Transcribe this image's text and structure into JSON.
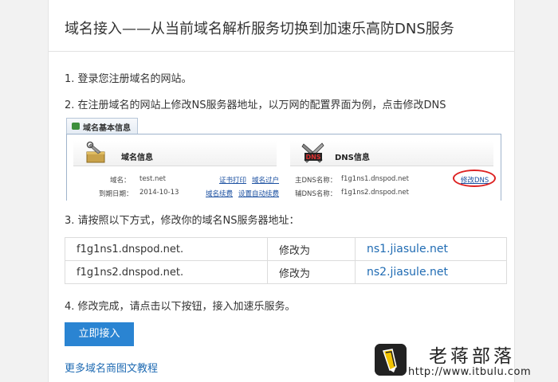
{
  "page": {
    "title": "域名接入——从当前域名解析服务切换到加速乐高防DNS服务"
  },
  "steps": {
    "step1": "1. 登录您注册域名的网站。",
    "step2": "2. 在注册域名的网站上修改NS服务器地址，以万网的配置界面为例，点击修改DNS",
    "step3": "3. 请按照以下方式，修改你的域名NS服务器地址：",
    "step4": "4. 修改完成，请点击以下按钮，接入加速乐服务。"
  },
  "screenshot": {
    "tab_label": "域名基本信息",
    "domain_section_title": "域名信息",
    "dns_section_title": "DNS信息",
    "domain_label": "域名：",
    "domain_value": "test.net",
    "expiry_label": "到期日期：",
    "expiry_value": "2014-10-13",
    "link_cert_print": "证书打印",
    "link_domain_transfer": "域名过户",
    "link_renew": "域名续费",
    "link_auto_renew": "设置自动续费",
    "primary_dns_label": "主DNS名称：",
    "primary_dns_value": "f1g1ns1.dnspod.net",
    "secondary_dns_label": "辅DNS名称：",
    "secondary_dns_value": "f1g1ns2.dnspod.net",
    "modify_dns_link": "修改DNS",
    "dns_icon_text": "DNS"
  },
  "ns_table": {
    "rows": [
      {
        "from": "f1g1ns1.dnspod.net.",
        "action": "修改为",
        "to": "ns1.jiasule.net"
      },
      {
        "from": "f1g1ns2.dnspod.net.",
        "action": "修改为",
        "to": "ns2.jiasule.net"
      }
    ]
  },
  "actions": {
    "connect_button": "立即接入",
    "more_tutorials_link": "更多域名商图文教程"
  },
  "watermark": {
    "title": "老蒋部落",
    "url": "http://www.itbulu.com"
  },
  "colors": {
    "accent_button": "#2a84d2",
    "link": "#1f6bb3",
    "highlight_circle": "#dd2222"
  },
  "icons": {
    "domain_tool": "wrench-box-icon",
    "dns_tool": "dns-tools-icon",
    "tab": "tab-icon",
    "watermark_logo": "pencil-logo-icon"
  }
}
